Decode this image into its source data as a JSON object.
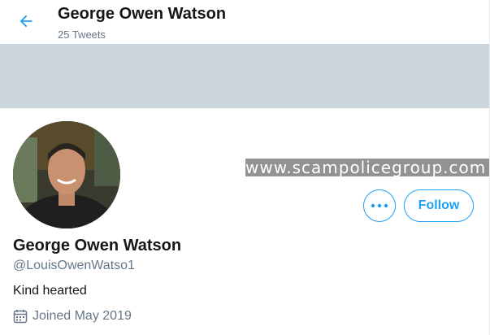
{
  "header": {
    "title": "George Owen Watson",
    "tweet_count": "25 Tweets",
    "back_icon": "back-arrow-icon"
  },
  "colors": {
    "accent": "#1da1f2",
    "banner": "#ccd6dd",
    "secondary_text": "#657786"
  },
  "watermark": {
    "text": "www.scampolicegroup.com"
  },
  "actions": {
    "more_icon": "more-dots-icon",
    "follow_label": "Follow"
  },
  "profile": {
    "name": "George Owen Watson",
    "handle": "@LouisOwenWatso1",
    "bio": "Kind hearted",
    "joined": "Joined May 2019",
    "joined_icon": "calendar-icon"
  }
}
